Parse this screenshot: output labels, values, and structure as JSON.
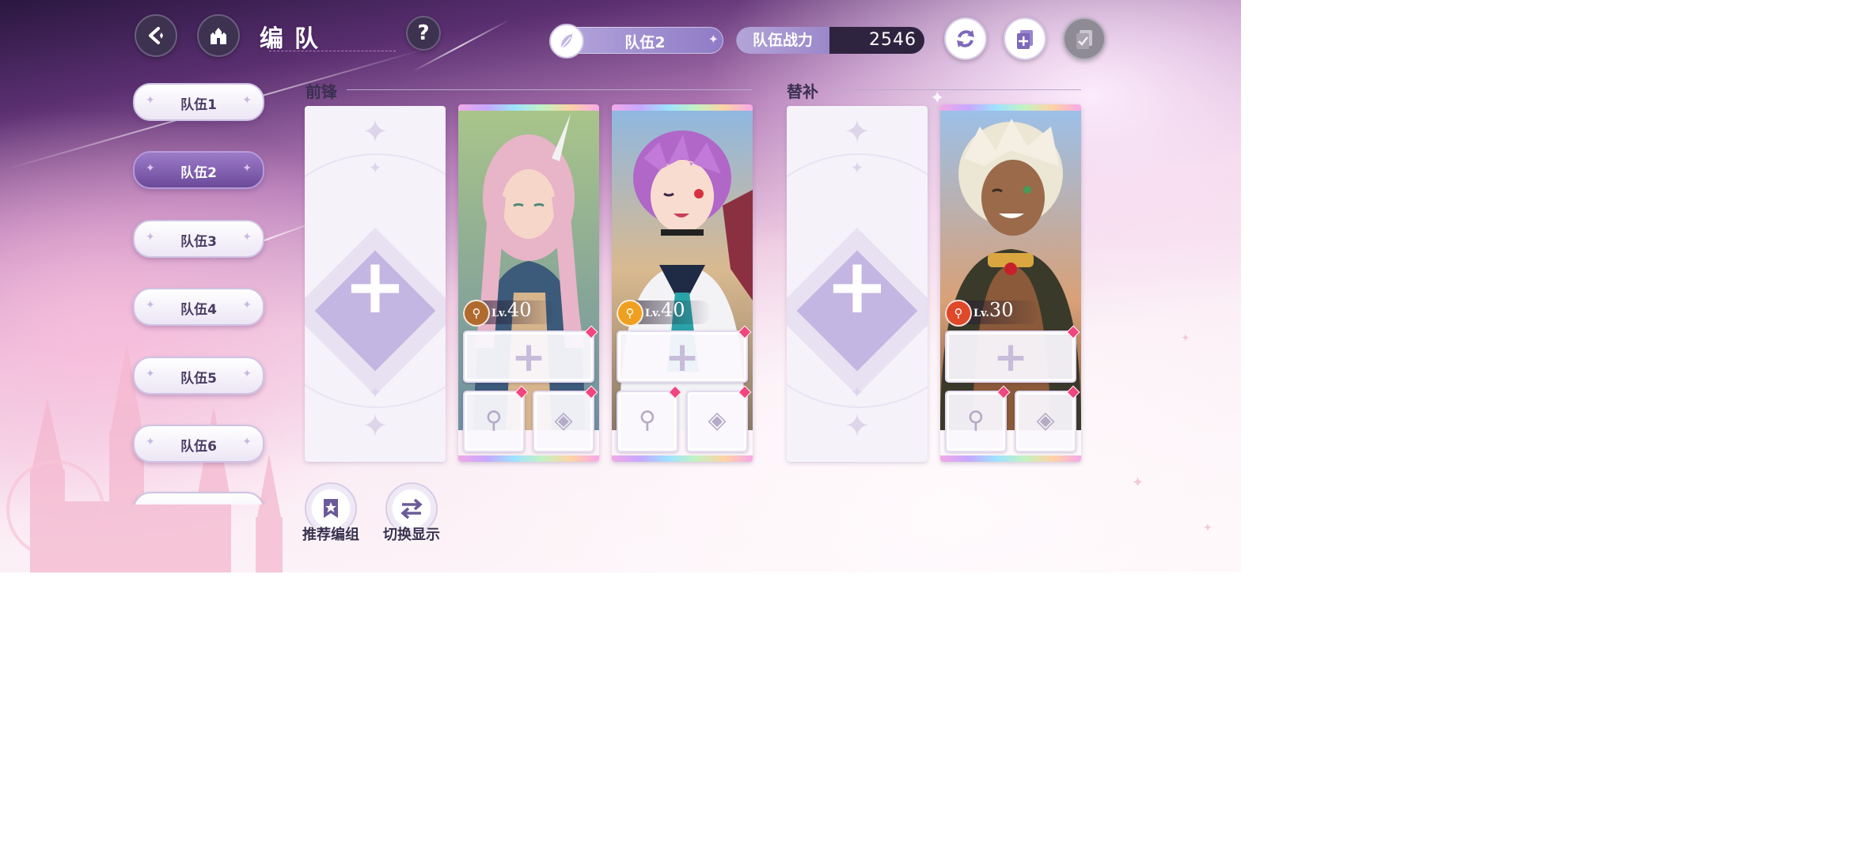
{
  "header": {
    "title": "编队",
    "current_team": "队伍2",
    "power_label": "队伍战力",
    "power_value": "2546"
  },
  "icons": {
    "back": "back-arrow-icon",
    "home": "castle-icon",
    "help": "question-icon",
    "feather": "feather-icon",
    "refresh": "refresh-icon",
    "copy": "copy-add-icon",
    "confirm": "clipboard-check-icon"
  },
  "teams": [
    {
      "label": "队伍1",
      "active": false
    },
    {
      "label": "队伍2",
      "active": true
    },
    {
      "label": "队伍3",
      "active": false
    },
    {
      "label": "队伍4",
      "active": false
    },
    {
      "label": "队伍5",
      "active": false
    },
    {
      "label": "队伍6",
      "active": false
    }
  ],
  "sections": {
    "front": "前锋",
    "sub": "替补"
  },
  "cards": [
    {
      "slot": "front-1",
      "empty": true
    },
    {
      "slot": "front-2",
      "empty": false,
      "level_prefix": "Lv.",
      "level": "40",
      "weapon_color": "#b06a2e"
    },
    {
      "slot": "front-3",
      "empty": false,
      "level_prefix": "Lv.",
      "level": "40",
      "weapon_color": "#f0a020"
    },
    {
      "slot": "sub-1",
      "empty": true
    },
    {
      "slot": "sub-2",
      "empty": false,
      "level_prefix": "Lv.",
      "level": "30",
      "weapon_color": "#e0482a"
    }
  ],
  "actions": {
    "recommend": "推荐编组",
    "toggle": "切换显示"
  },
  "colors": {
    "accent": "#8e7bc6",
    "gem": "#f0457f"
  }
}
